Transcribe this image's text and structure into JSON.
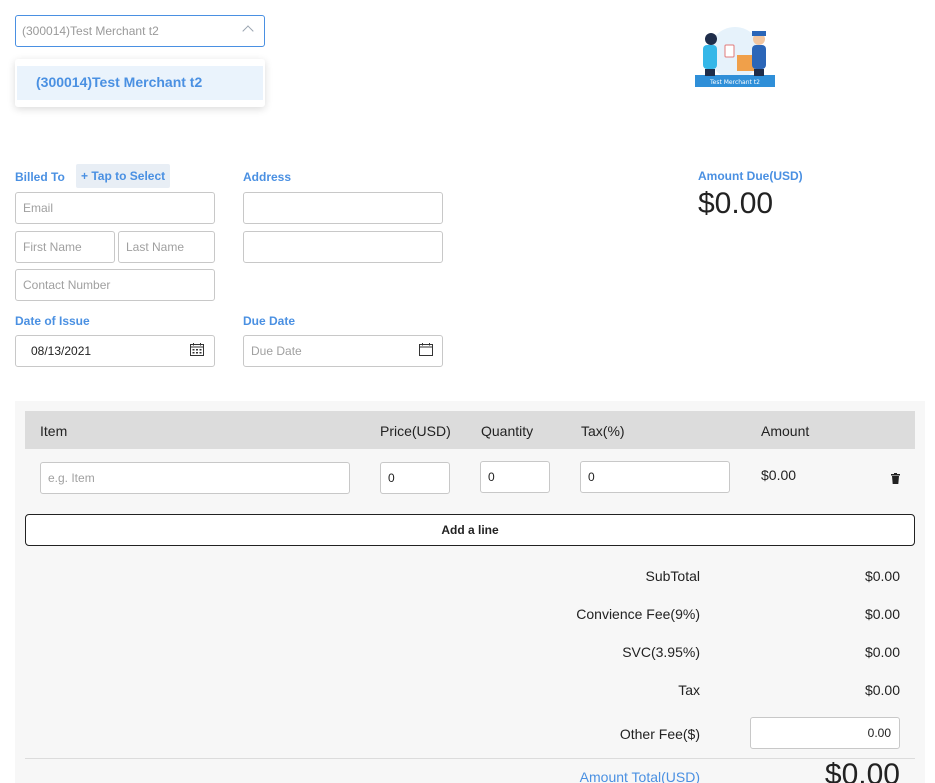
{
  "merchant": {
    "selected": "(300014)Test Merchant t2",
    "options": [
      "(300014)Test Merchant t2"
    ]
  },
  "logo": {
    "caption": "Test Merchant t2"
  },
  "billed_to": {
    "label": "Billed To",
    "tap_select": "+ Tap to Select",
    "email_placeholder": "Email",
    "first_name_placeholder": "First Name",
    "last_name_placeholder": "Last Name",
    "contact_placeholder": "Contact Number"
  },
  "address": {
    "label": "Address"
  },
  "date_of_issue": {
    "label": "Date of Issue",
    "value": "08/13/2021"
  },
  "due_date": {
    "label": "Due Date",
    "placeholder": "Due Date"
  },
  "amount_due": {
    "label": "Amount Due(USD)",
    "value": "$0.00"
  },
  "table": {
    "headers": {
      "item": "Item",
      "price": "Price(USD)",
      "quantity": "Quantity",
      "tax": "Tax(%)",
      "amount": "Amount"
    },
    "rows": [
      {
        "item_placeholder": "e.g. Item",
        "price": "0",
        "quantity": "0",
        "tax": "0",
        "amount": "$0.00"
      }
    ],
    "add_line": "Add a line"
  },
  "summary": {
    "subtotal_label": "SubTotal",
    "subtotal": "$0.00",
    "convenience_label": "Convience Fee(9%)",
    "convenience": "$0.00",
    "svc_label": "SVC(3.95%)",
    "svc": "$0.00",
    "tax_label": "Tax",
    "tax": "$0.00",
    "other_fee_label": "Other Fee($)",
    "other_fee": "0.00",
    "total_label": "Amount Total(USD)",
    "total": "$0.00"
  },
  "colors": {
    "accent": "#4a90e2",
    "header_bg": "#dcdcdc",
    "panel_bg": "#f7f7f7"
  }
}
